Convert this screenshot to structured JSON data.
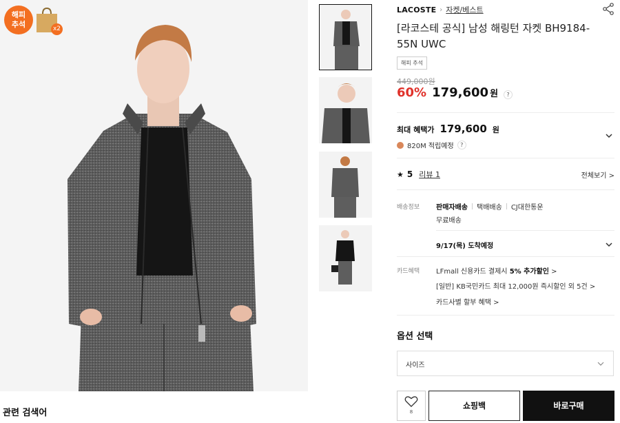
{
  "badges": {
    "happy_line1": "해피",
    "happy_line2": "추석",
    "bag_count": "x2"
  },
  "related_search_label": "관련 검색어",
  "product": {
    "brand": "LACOSTE",
    "category": "자켓/베스트",
    "title": "[라코스테 공식] 남성 해링턴 자켓 BH9184-55N UWC",
    "tag": "해피 추석",
    "original_price": "449,000원",
    "discount": "60%",
    "price": "179,600",
    "price_unit": "원"
  },
  "benefit": {
    "label": "최대 혜택가",
    "price": "179,600",
    "unit": "원",
    "points": "820M 적립예정"
  },
  "review": {
    "rating": "5",
    "link": "리뷰 1",
    "view_all": "전체보기 >"
  },
  "shipping": {
    "label": "배송정보",
    "type": "판매자배송",
    "method": "택배배송",
    "carrier": "CJ대한통운",
    "fee": "무료배송",
    "arrival": "9/17(목) 도착예정"
  },
  "card": {
    "label": "카드혜택",
    "line1_prefix": "LFmall 신용카드 결제시 ",
    "line1_bold": "5% 추가할인",
    "line1_suffix": " >",
    "line2": "[일반] KB국민카드 최대 12,000원 즉시할인 외 5건 >",
    "line3": "카드사별 할부 혜택 >"
  },
  "options": {
    "title": "옵션 선택",
    "size_placeholder": "사이즈"
  },
  "actions": {
    "wish_count": "8",
    "cart": "쇼핑백",
    "buy": "바로구매"
  },
  "colors": {
    "accent": "#f36f21",
    "discount": "#e0322b",
    "jacket": "#5a5a5a"
  }
}
